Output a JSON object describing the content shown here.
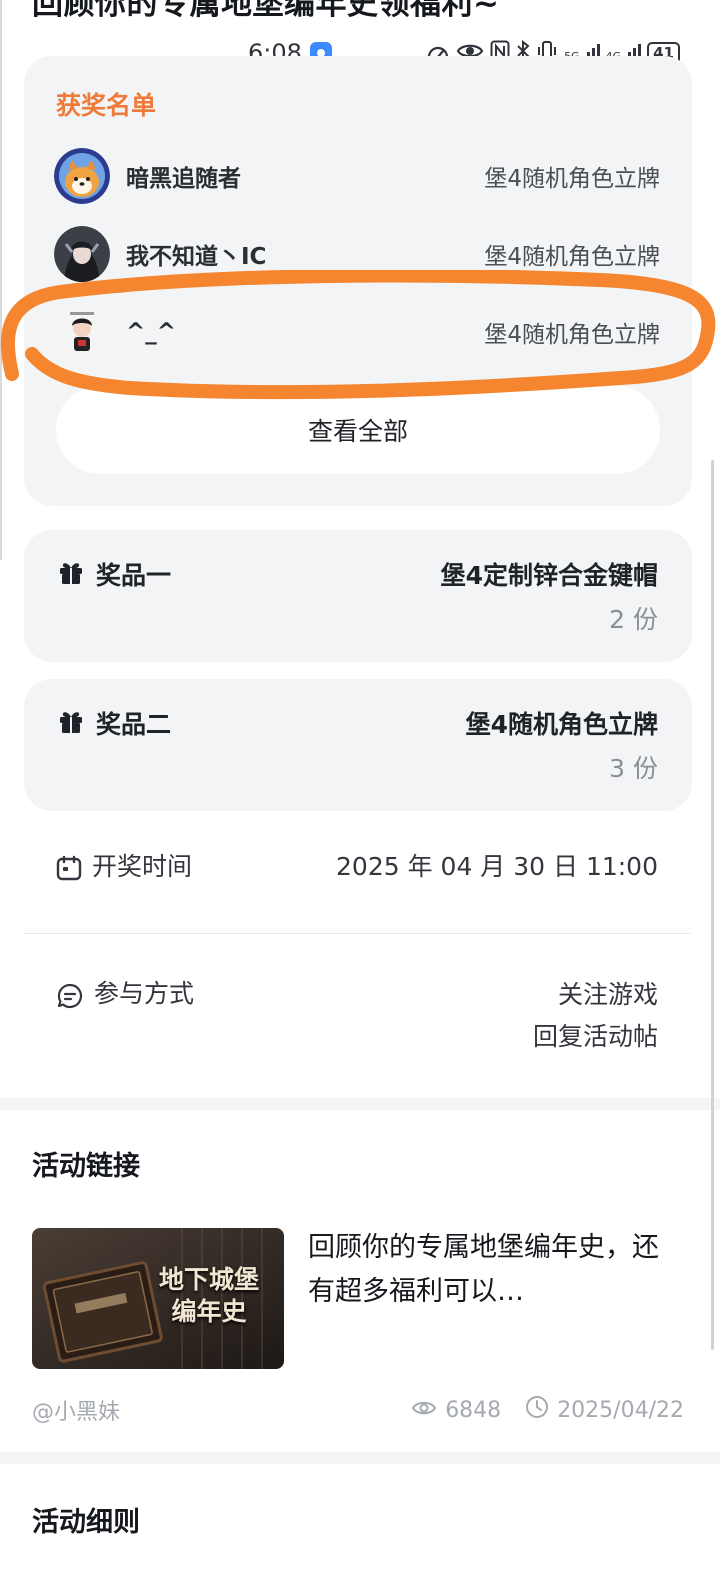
{
  "header": {
    "page_title_cut": "回顾你的专属地堡编年史领福利~"
  },
  "status_bar": {
    "time": "6:08",
    "net_5g": "5G",
    "net_4g": "4G",
    "battery": "41"
  },
  "winners": {
    "title": "获奖名单",
    "items": [
      {
        "name": "暗黑追随者",
        "prize": "堡4随机角色立牌"
      },
      {
        "name": "我不知道丶IC",
        "prize": "堡4随机角色立牌"
      },
      {
        "name": "^_^",
        "prize": "堡4随机角色立牌"
      }
    ],
    "view_all_label": "查看全部"
  },
  "prizes": [
    {
      "label": "奖品一",
      "name": "堡4定制锌合金键帽",
      "count": "2 份"
    },
    {
      "label": "奖品二",
      "name": "堡4随机角色立牌",
      "count": "3 份"
    }
  ],
  "draw_time": {
    "label": "开奖时间",
    "value": "2025 年 04 月 30 日 11:00"
  },
  "participation": {
    "label": "参与方式",
    "steps": [
      "关注游戏",
      "回复活动帖"
    ]
  },
  "activity_link": {
    "section_title": "活动链接",
    "thumb_title_line1": "地下城堡",
    "thumb_title_line2": "编年史",
    "description": "回顾你的专属地堡编年史，还有超多福利可以…",
    "author": "@小黑妹",
    "views": "6848",
    "date": "2025/04/22"
  },
  "rules": {
    "section_title": "活动细则"
  },
  "colors": {
    "accent_orange": "#ef7b3a",
    "annotation_orange": "#f5852e",
    "card_bg": "#f3f4f6"
  }
}
